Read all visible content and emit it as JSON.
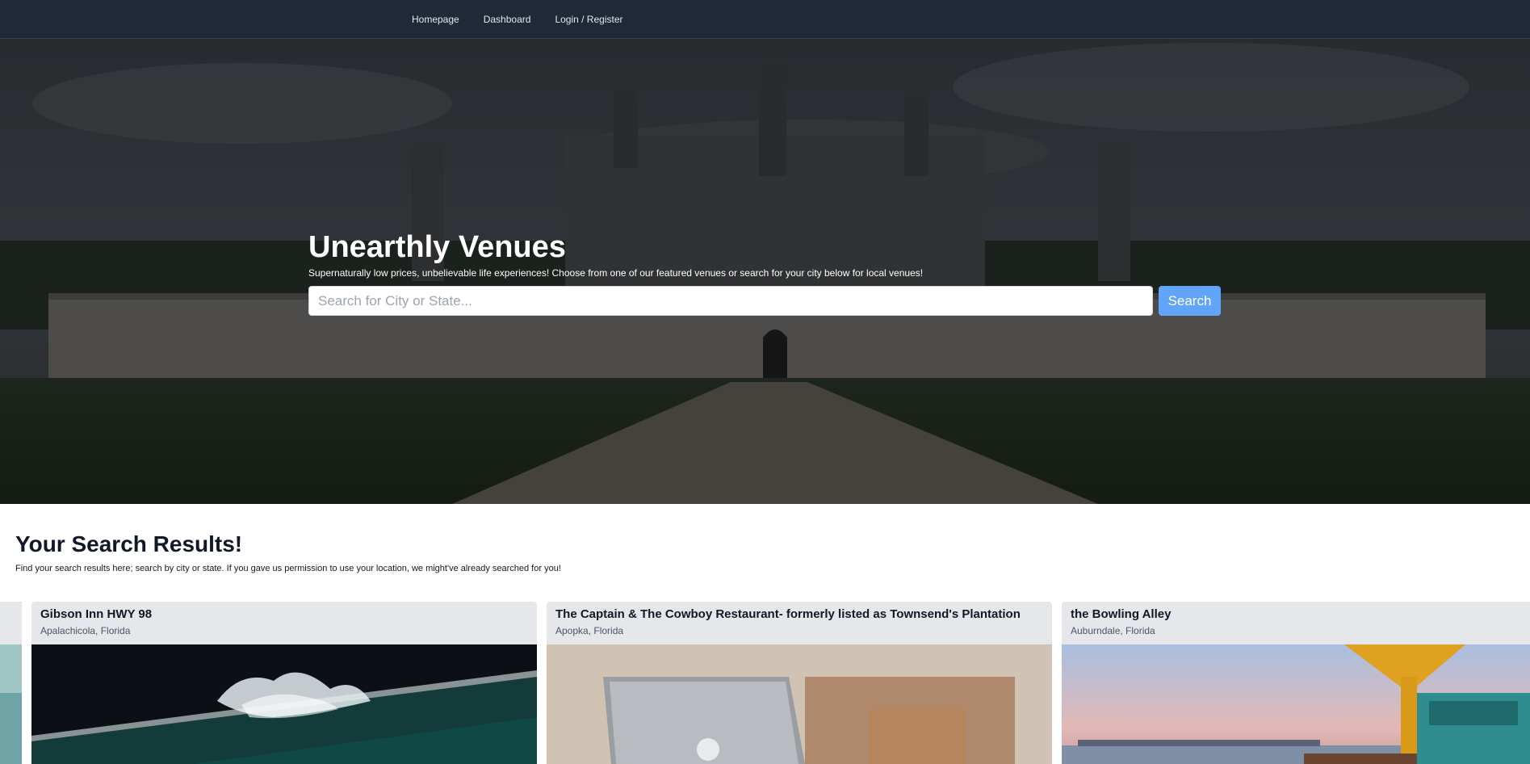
{
  "nav": {
    "links": [
      "Homepage",
      "Dashboard",
      "Login / Register"
    ]
  },
  "hero": {
    "title": "Unearthly Venues",
    "subtitle": "Supernaturally low prices, unbelievable life experiences! Choose from one of our featured venues or search for your city below for local venues!",
    "search_placeholder": "Search for City or State...",
    "search_button": "Search"
  },
  "results": {
    "title": "Your Search Results!",
    "description": "Find your search results here; search by city or state. If you gave us permission to use your location, we might've already searched for you!",
    "cards": [
      {
        "title": "Gibson Inn HWY 98",
        "location": "Apalachicola, Florida"
      },
      {
        "title": "The Captain & The Cowboy Restaurant- formerly listed as Townsend's Plantation",
        "location": "Apopka, Florida"
      },
      {
        "title": "the Bowling Alley",
        "location": "Auburndale, Florida"
      }
    ]
  },
  "colors": {
    "navbar": "#1f2937",
    "accent": "#60a5fa",
    "card_bg": "#e5e7eb"
  }
}
